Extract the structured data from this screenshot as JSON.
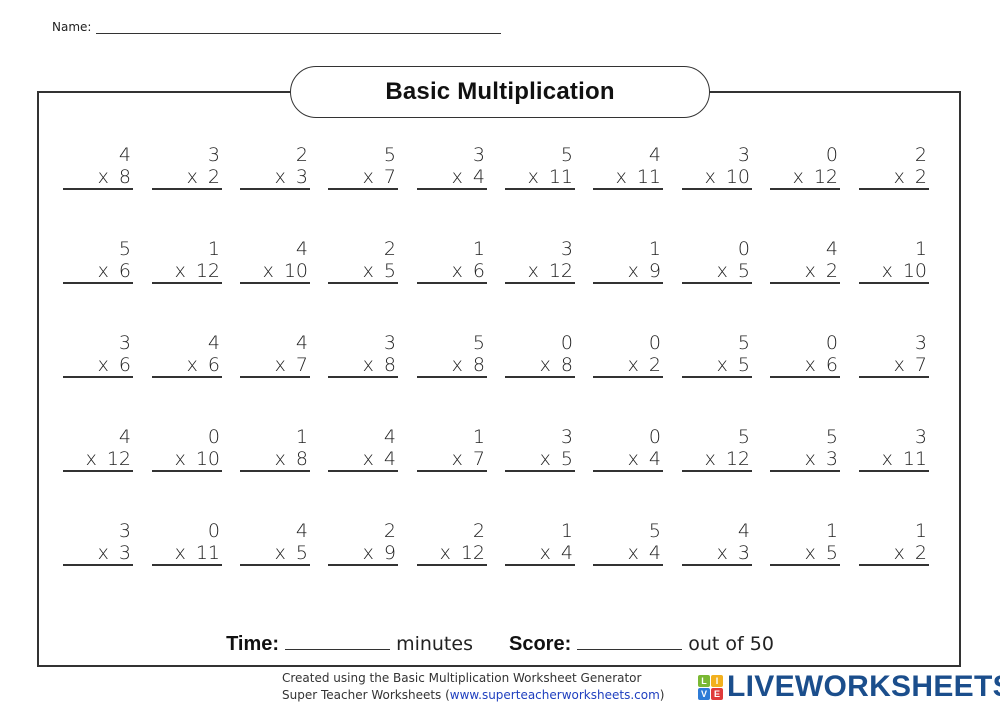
{
  "header": {
    "name_label": "Name:",
    "title": "Basic Multiplication"
  },
  "problems": [
    [
      {
        "top": "4",
        "bottom": "8"
      },
      {
        "top": "3",
        "bottom": "2"
      },
      {
        "top": "2",
        "bottom": "3"
      },
      {
        "top": "5",
        "bottom": "7"
      },
      {
        "top": "3",
        "bottom": "4"
      },
      {
        "top": "5",
        "bottom": "11"
      },
      {
        "top": "4",
        "bottom": "11"
      },
      {
        "top": "3",
        "bottom": "10"
      },
      {
        "top": "0",
        "bottom": "12"
      },
      {
        "top": "2",
        "bottom": "2"
      }
    ],
    [
      {
        "top": "5",
        "bottom": "6"
      },
      {
        "top": "1",
        "bottom": "12"
      },
      {
        "top": "4",
        "bottom": "10"
      },
      {
        "top": "2",
        "bottom": "5"
      },
      {
        "top": "1",
        "bottom": "6"
      },
      {
        "top": "3",
        "bottom": "12"
      },
      {
        "top": "1",
        "bottom": "9"
      },
      {
        "top": "0",
        "bottom": "5"
      },
      {
        "top": "4",
        "bottom": "2"
      },
      {
        "top": "1",
        "bottom": "10"
      }
    ],
    [
      {
        "top": "3",
        "bottom": "6"
      },
      {
        "top": "4",
        "bottom": "6"
      },
      {
        "top": "4",
        "bottom": "7"
      },
      {
        "top": "3",
        "bottom": "8"
      },
      {
        "top": "5",
        "bottom": "8"
      },
      {
        "top": "0",
        "bottom": "8"
      },
      {
        "top": "0",
        "bottom": "2"
      },
      {
        "top": "5",
        "bottom": "5"
      },
      {
        "top": "0",
        "bottom": "6"
      },
      {
        "top": "3",
        "bottom": "7"
      }
    ],
    [
      {
        "top": "4",
        "bottom": "12"
      },
      {
        "top": "0",
        "bottom": "10"
      },
      {
        "top": "1",
        "bottom": "8"
      },
      {
        "top": "4",
        "bottom": "4"
      },
      {
        "top": "1",
        "bottom": "7"
      },
      {
        "top": "3",
        "bottom": "5"
      },
      {
        "top": "0",
        "bottom": "4"
      },
      {
        "top": "5",
        "bottom": "12"
      },
      {
        "top": "5",
        "bottom": "3"
      },
      {
        "top": "3",
        "bottom": "11"
      }
    ],
    [
      {
        "top": "3",
        "bottom": "3"
      },
      {
        "top": "0",
        "bottom": "11"
      },
      {
        "top": "4",
        "bottom": "5"
      },
      {
        "top": "2",
        "bottom": "9"
      },
      {
        "top": "2",
        "bottom": "12"
      },
      {
        "top": "1",
        "bottom": "4"
      },
      {
        "top": "5",
        "bottom": "4"
      },
      {
        "top": "4",
        "bottom": "3"
      },
      {
        "top": "1",
        "bottom": "5"
      },
      {
        "top": "1",
        "bottom": "2"
      }
    ]
  ],
  "operator": "x",
  "footer": {
    "time_label": "Time:",
    "time_unit": "minutes",
    "score_label": "Score:",
    "score_suffix": "out of 50"
  },
  "credits": {
    "line1": "Created using the Basic Multiplication Worksheet Generator",
    "line2_prefix": "Super Teacher Worksheets (",
    "line2_url": "www.superteacherworksheets.com",
    "line2_suffix": ")"
  },
  "logo": {
    "letters": [
      "L",
      "I",
      "V",
      "E"
    ],
    "colors": [
      "#7ab833",
      "#f2b01e",
      "#2e7bd6",
      "#e03a3a"
    ],
    "text": "LIVEWORKSHEETS",
    "text_color": "#1b4e8c"
  }
}
